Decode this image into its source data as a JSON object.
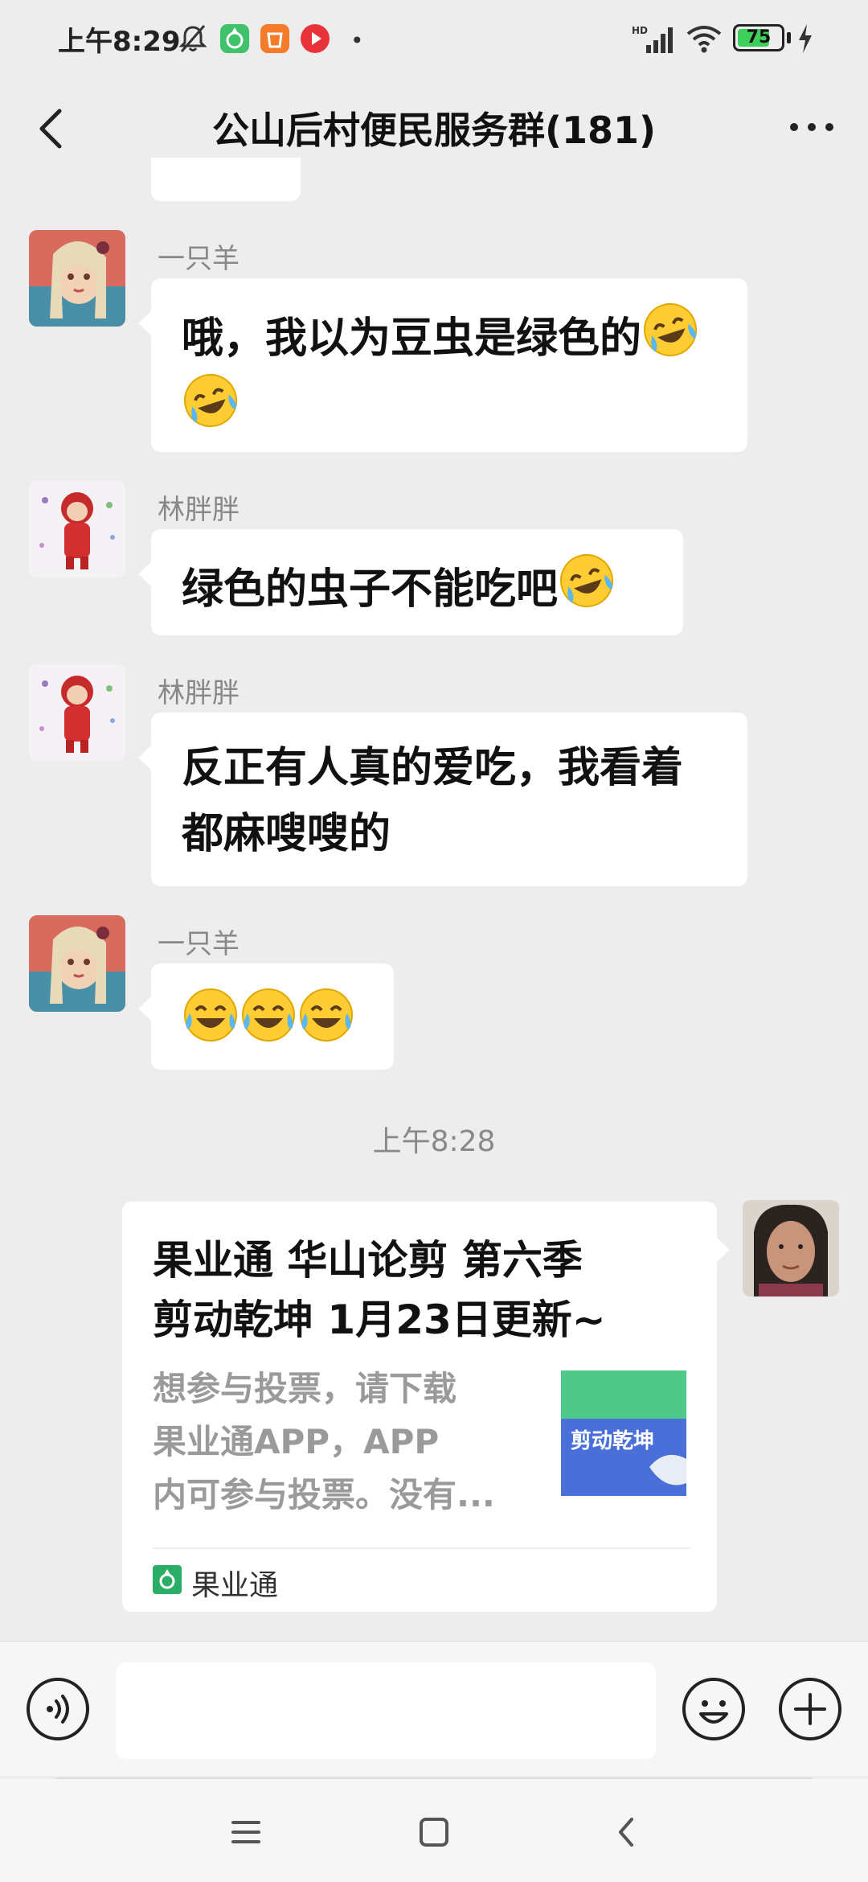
{
  "status_bar": {
    "time": "上午8:29",
    "battery_level": "75",
    "battery_percent": 75,
    "network": "HD",
    "icons": [
      "mute-bell-icon",
      "app-green-icon",
      "app-orange-icon",
      "app-red-play-icon",
      "signal-icon",
      "wifi-icon",
      "battery-icon",
      "charging-icon"
    ]
  },
  "header": {
    "title": "公山后村便民服务群(181)",
    "back_icon": "chevron-left-icon",
    "more_icon": "more-dots-icon"
  },
  "messages": [
    {
      "sender": "一只羊",
      "text": "哦，我以为豆虫是绿色的",
      "emojis": [
        "laugh-cry-tilted",
        "laugh-cry-tilted"
      ]
    },
    {
      "sender": "林胖胖",
      "text": "绿色的虫子不能吃吧",
      "emojis": [
        "laugh-cry-tilted"
      ]
    },
    {
      "sender": "林胖胖",
      "text_line1": "反正有人真的爱吃，我看着",
      "text_line2": "都麻嗖嗖的"
    },
    {
      "sender": "一只羊",
      "emojis": [
        "joy",
        "joy",
        "joy"
      ]
    }
  ],
  "timestamp": "上午8:28",
  "link_card": {
    "title_line1": "果业通 华山论剪 第六季",
    "title_line2": "剪动乾坤 1月23日更新~",
    "desc_line1": "想参与投票，请下载",
    "desc_line2": "果业通APP，APP",
    "desc_line3": "内可参与投票。没有...",
    "source": "果业通",
    "thumb_text": "剪动乾坤"
  },
  "input_bar": {
    "voice_icon": "voice-icon",
    "emoji_icon": "emoji-icon",
    "add_icon": "add-icon",
    "text_value": ""
  },
  "colors": {
    "background": "#ededed",
    "bubble": "#ffffff",
    "battery_green": "#3ecf5b",
    "brand_green": "#2aae67"
  }
}
